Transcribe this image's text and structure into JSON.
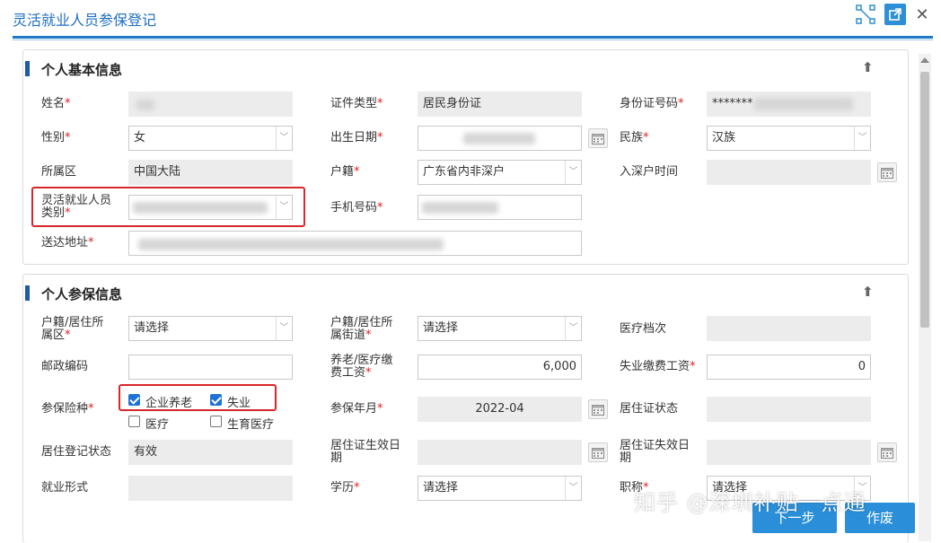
{
  "window": {
    "title": "灵活就业人员参保登记"
  },
  "section1": {
    "title": "个人基本信息",
    "fields": {
      "name": {
        "label": "姓名"
      },
      "id_type": {
        "label": "证件类型",
        "value": "居民身份证"
      },
      "id_number": {
        "label": "身份证号码",
        "value": "*******"
      },
      "gender": {
        "label": "性别",
        "value": "女"
      },
      "birth_date": {
        "label": "出生日期"
      },
      "ethnicity": {
        "label": "民族",
        "value": "汉族"
      },
      "region": {
        "label": "所属区",
        "value": "中国大陆"
      },
      "hukou": {
        "label": "户籍",
        "value": "广东省内非深户"
      },
      "shenzhen_entry": {
        "label": "入深户时间"
      },
      "flex_category": {
        "label_line1": "灵活就业人员",
        "label_line2": "类别"
      },
      "phone": {
        "label": "手机号码"
      },
      "address": {
        "label": "送达地址"
      }
    }
  },
  "section2": {
    "title": "个人参保信息",
    "fields": {
      "hukou_district": {
        "label_line1": "户籍/居住所",
        "label_line2": "属区",
        "value": "请选择"
      },
      "hukou_street": {
        "label_line1": "户籍/居住所",
        "label_line2": "属街道",
        "value": "请选择"
      },
      "medical_level": {
        "label": "医疗档次"
      },
      "postal_code": {
        "label": "邮政编码"
      },
      "pension_wage": {
        "label_line1": "养老/医疗缴",
        "label_line2": "费工资",
        "value": "6,000"
      },
      "unemployment_wage": {
        "label": "失业缴费工资",
        "value": "0"
      },
      "insurance_types": {
        "label": "参保险种",
        "options": [
          {
            "label": "企业养老",
            "checked": true
          },
          {
            "label": "失业",
            "checked": true
          },
          {
            "label": "医疗",
            "checked": false
          },
          {
            "label": "生育医疗",
            "checked": false
          }
        ]
      },
      "insured_month": {
        "label": "参保年月",
        "value": "2022-04"
      },
      "permit_status": {
        "label": "居住证状态"
      },
      "residence_status": {
        "label": "居住登记状态",
        "value": "有效"
      },
      "permit_start": {
        "label_line1": "居住证生效日",
        "label_line2": "期"
      },
      "permit_end": {
        "label_line1": "居住证失效日",
        "label_line2": "期"
      },
      "employment_form": {
        "label": "就业形式"
      },
      "education": {
        "label": "学历",
        "value": "请选择"
      },
      "title_rank": {
        "label": "职称",
        "value": "请选择"
      }
    }
  },
  "buttons": {
    "next": "下一步",
    "void": "作废"
  },
  "watermark": "知乎 @深圳补贴一点通"
}
